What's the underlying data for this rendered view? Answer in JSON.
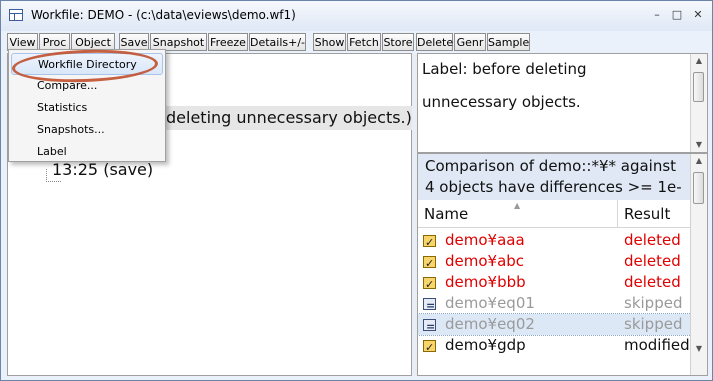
{
  "window": {
    "title": "Workfile: DEMO - (c:\\data\\eviews\\demo.wf1)",
    "controls": {
      "minimize": "–",
      "maximize": "□",
      "close": "✕"
    }
  },
  "toolbar": {
    "buttons": [
      "View",
      "Proc",
      "Object",
      "Save",
      "Snapshot",
      "Freeze",
      "Details+/-",
      "Show",
      "Fetch",
      "Store",
      "Delete",
      "Genr",
      "Sample"
    ]
  },
  "menu": {
    "items": [
      "Workfile Directory",
      "Compare...",
      "Statistics",
      "Snapshots...",
      "Label"
    ],
    "highlighted_index": 0
  },
  "left_pane": {
    "row1": "deleting unnecessary objects.)",
    "row2": "13:25 (save)"
  },
  "label_area": {
    "line1": "Label: before deleting",
    "line2": "unnecessary objects."
  },
  "comparison": {
    "header_line1": "Comparison of demo::*¥* against",
    "header_line2": "4 objects have differences >= 1e-",
    "columns": {
      "name": "Name",
      "result": "Result"
    },
    "rows": [
      {
        "icon": "series-icon",
        "name": "demo¥aaa",
        "result": "deleted",
        "color": "#e00000",
        "selected": false
      },
      {
        "icon": "series-icon",
        "name": "demo¥abc",
        "result": "deleted",
        "color": "#e00000",
        "selected": false
      },
      {
        "icon": "series-icon",
        "name": "demo¥bbb",
        "result": "deleted",
        "color": "#e00000",
        "selected": false
      },
      {
        "icon": "equation-icon",
        "name": "demo¥eq01",
        "result": "skipped",
        "color": "#9a9a9a",
        "selected": false
      },
      {
        "icon": "equation-icon",
        "name": "demo¥eq02",
        "result": "skipped",
        "color": "#9a9a9a",
        "selected": true
      },
      {
        "icon": "series-icon",
        "name": "demo¥gdp",
        "result": "modified",
        "color": "#111111",
        "selected": false
      }
    ]
  },
  "colors": {
    "accent_ellipse": "#c0502e",
    "deleted": "#e00000",
    "skipped": "#9a9a9a"
  }
}
